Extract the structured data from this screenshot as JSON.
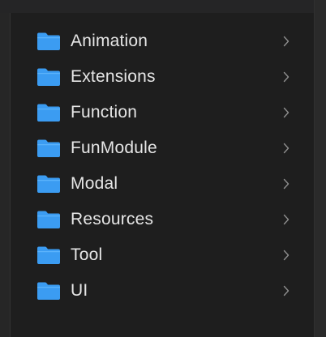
{
  "colors": {
    "folder": "#3b9cf2",
    "folder_top": "#5cb3fb",
    "text": "#e6e6e6",
    "chevron": "#8e8e8e",
    "background": "#1e1e1e"
  },
  "folders": [
    {
      "label": "Animation",
      "icon": "folder-icon"
    },
    {
      "label": "Extensions",
      "icon": "folder-icon"
    },
    {
      "label": "Function",
      "icon": "folder-icon"
    },
    {
      "label": "FunModule",
      "icon": "folder-icon"
    },
    {
      "label": "Modal",
      "icon": "folder-icon"
    },
    {
      "label": "Resources",
      "icon": "folder-icon"
    },
    {
      "label": "Tool",
      "icon": "folder-icon"
    },
    {
      "label": "UI",
      "icon": "folder-icon"
    }
  ]
}
